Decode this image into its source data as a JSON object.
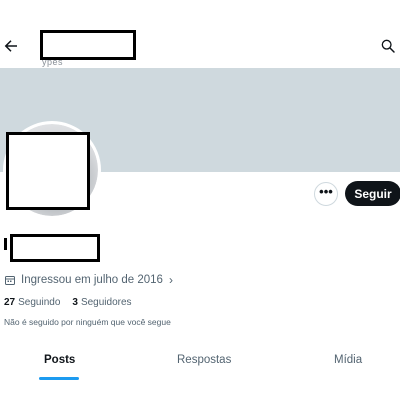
{
  "header": {
    "back_icon": "arrow-left-icon",
    "search_icon": "search-icon",
    "subtitle_fragment": "ypes"
  },
  "profile": {
    "banner_color": "#cfd9de",
    "more_label": "•••",
    "follow_label": "Seguir",
    "joined_icon": "calendar-icon",
    "joined": "Ingressou em julho de 2016",
    "following_count": "27",
    "following_label": "Seguindo",
    "followers_count": "3",
    "followers_label": "Seguidores",
    "notice": "Não é seguido por ninguém que você segue"
  },
  "tabs": [
    {
      "label": "Posts",
      "active": true
    },
    {
      "label": "Respostas",
      "active": false
    },
    {
      "label": "Mídia",
      "active": false
    }
  ],
  "colors": {
    "accent": "#1d9bf0",
    "button_dark": "#0f1419",
    "secondary_text": "#536471"
  }
}
